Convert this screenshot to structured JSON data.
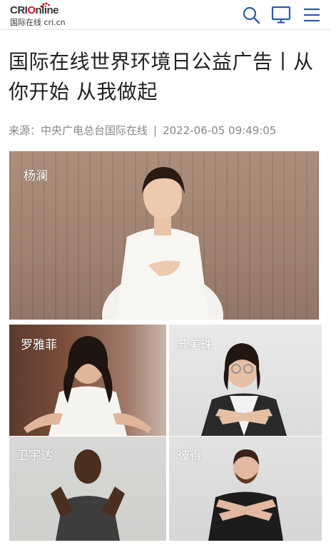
{
  "header": {
    "logo_top_prefix": "CRI",
    "logo_top_suffix": "nline",
    "logo_bottom": "国际在线 cri.cn",
    "icons": [
      "search-icon",
      "tv-icon",
      "menu-icon"
    ]
  },
  "article": {
    "title": "国际在线世界环境日公益广告丨从你开始 从我做起",
    "source": "来源：中央广电总台国际在线",
    "separator": "|",
    "datetime": "2022-06-05 09:49:05"
  },
  "photos": [
    {
      "label": "杨澜"
    },
    {
      "label": "罗雅菲"
    },
    {
      "label": "苏美珠"
    },
    {
      "label": "卫宇达"
    },
    {
      "label": "彼得"
    }
  ],
  "colors": {
    "brand_red": "#d7141a",
    "icon_blue": "#2f5aa8",
    "meta_gray": "#888888"
  }
}
